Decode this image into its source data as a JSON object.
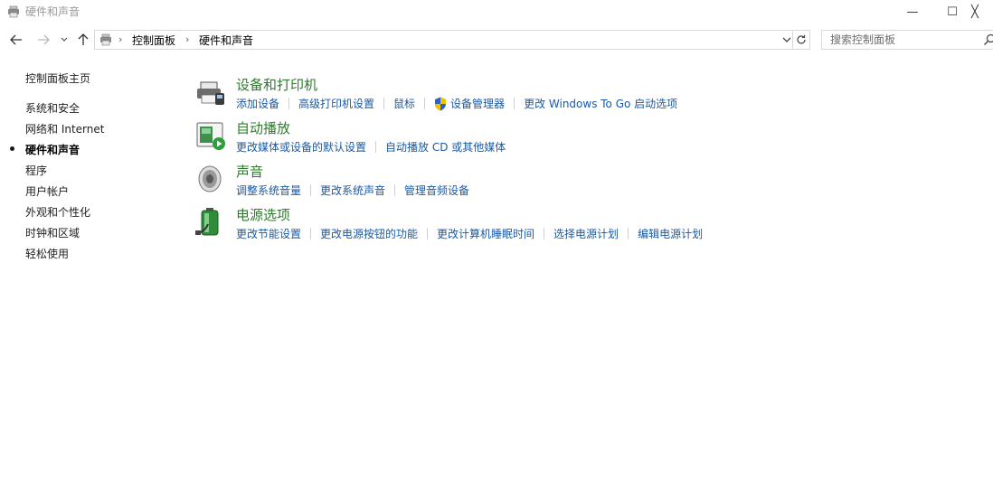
{
  "window": {
    "title": "硬件和声音",
    "minimize_glyph": "—",
    "maximize_glyph": "☐",
    "close_glyph": "╳"
  },
  "address": {
    "crumbs": [
      "控制面板",
      "硬件和声音"
    ],
    "separator": "›"
  },
  "search": {
    "placeholder": "搜索控制面板"
  },
  "sidebar": {
    "home": "控制面板主页",
    "items": [
      "系统和安全",
      "网络和 Internet",
      "硬件和声音",
      "程序",
      "用户帐户",
      "外观和个性化",
      "时钟和区域",
      "轻松使用"
    ],
    "current_index": 2
  },
  "categories": [
    {
      "title": "设备和打印机",
      "icon": "printer-icon",
      "links": [
        "添加设备",
        "高级打印机设置",
        "鼠标",
        "设备管理器",
        "更改 Windows To Go 启动选项"
      ]
    },
    {
      "title": "自动播放",
      "icon": "autoplay-icon",
      "links": [
        "更改媒体或设备的默认设置",
        "自动播放 CD 或其他媒体"
      ]
    },
    {
      "title": "声音",
      "icon": "speaker-icon",
      "links": [
        "调整系统音量",
        "更改系统声音",
        "管理音频设备"
      ]
    },
    {
      "title": "电源选项",
      "icon": "battery-icon",
      "links": [
        "更改节能设置",
        "更改电源按钮的功能",
        "更改计算机睡眠时间",
        "选择电源计划",
        "编辑电源计划"
      ]
    }
  ],
  "colors": {
    "category_title": "#2e7b2e",
    "link": "#1a5aa6",
    "border": "#d9d9d9"
  }
}
